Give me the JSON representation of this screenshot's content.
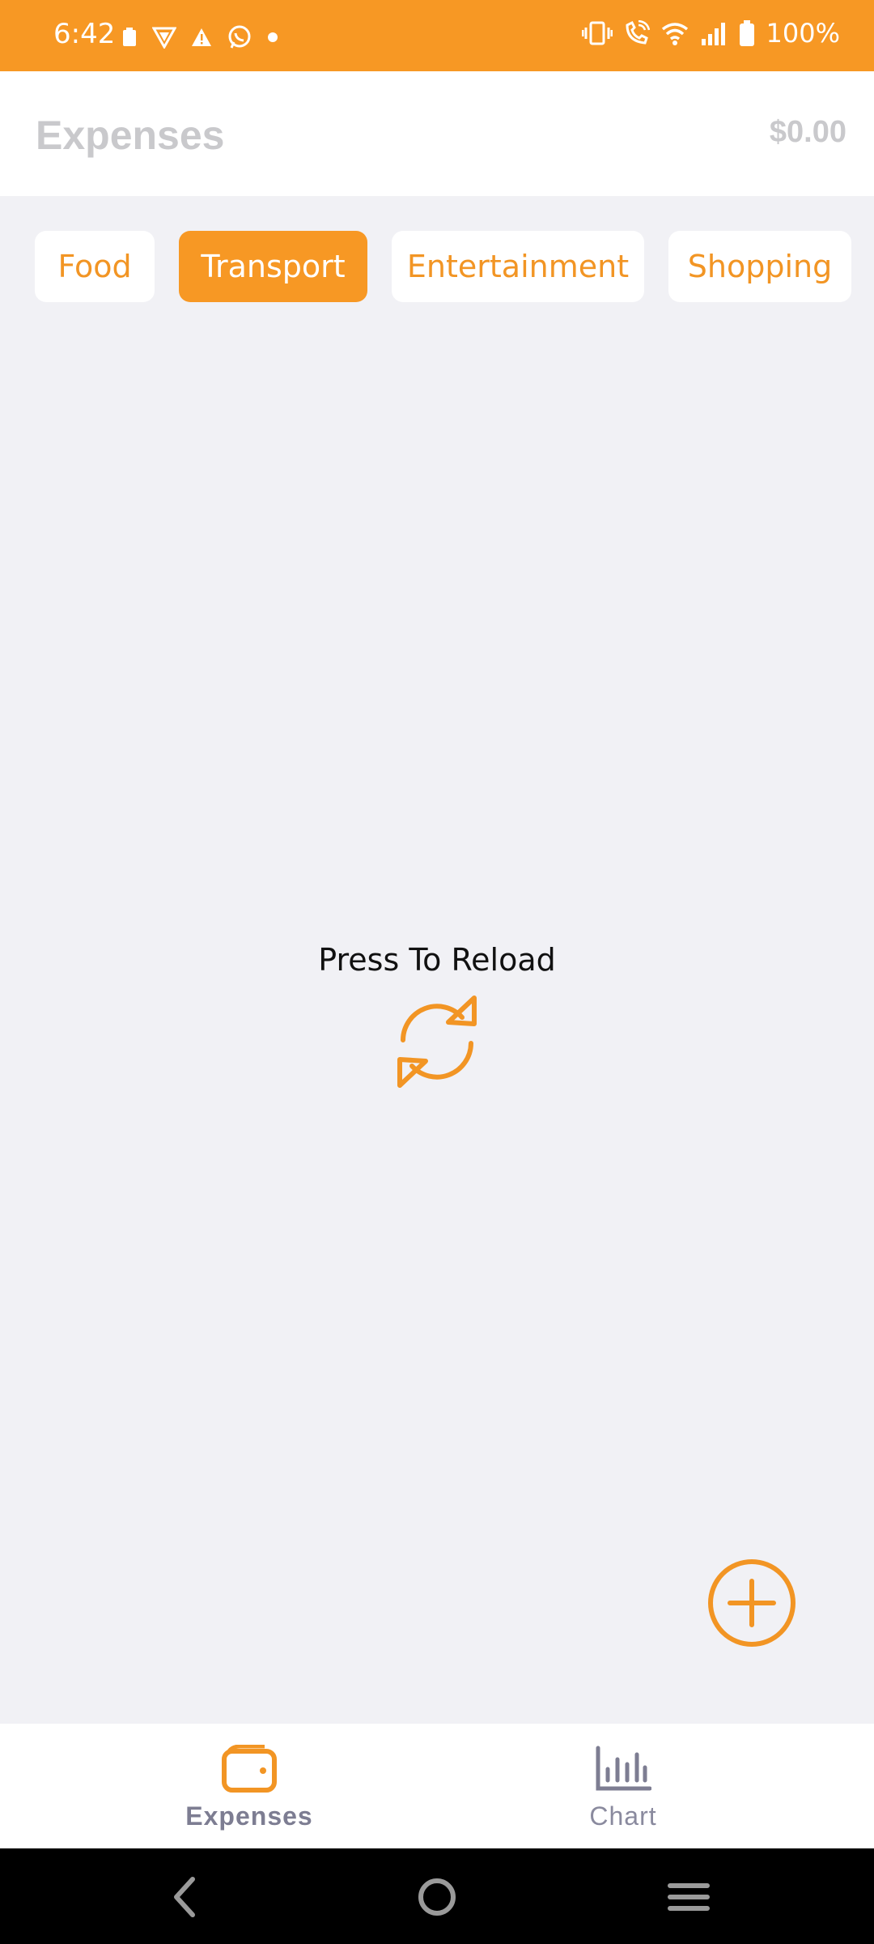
{
  "status_bar": {
    "time": "6:42",
    "battery": "100%",
    "left_icons": [
      "battery-saver-icon",
      "shield-icon",
      "warning-icon",
      "whatsapp-icon",
      "dot-icon"
    ],
    "right_icons": [
      "vibrate-icon",
      "wifi-calling-icon",
      "wifi-icon",
      "signal-icon",
      "battery-icon"
    ],
    "color": "#f79824"
  },
  "header": {
    "title": "Expenses",
    "total": "$0.00"
  },
  "categories": [
    {
      "label": "Food",
      "active": false
    },
    {
      "label": "Transport",
      "active": true
    },
    {
      "label": "Entertainment",
      "active": false
    },
    {
      "label": "Shopping",
      "active": false
    }
  ],
  "empty_state": {
    "message": "Press To Reload",
    "icon": "refresh-icon"
  },
  "fab": {
    "icon": "add-circle-icon"
  },
  "bottom_nav": {
    "items": [
      {
        "label": "Expenses",
        "icon": "wallet-icon",
        "active": true
      },
      {
        "label": "Chart",
        "icon": "bar-chart-icon",
        "active": false
      }
    ]
  },
  "system_nav": [
    "back-icon",
    "home-icon",
    "recents-icon"
  ],
  "colors": {
    "accent": "#f79824",
    "background": "#f1f1f5"
  }
}
